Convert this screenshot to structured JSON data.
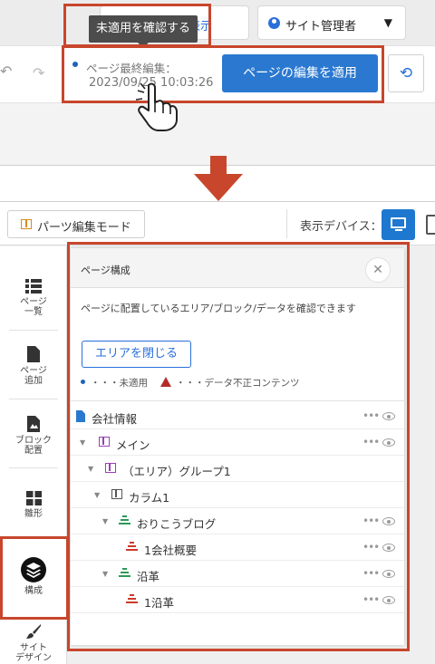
{
  "top": {
    "public_page_button": "公開画面を表示",
    "site_admin_label": "サイト管理者",
    "last_edit_label": "ページ最終編集：",
    "last_edit_date": "2023/09/25 10:03:26",
    "apply_button": "ページの編集を適用",
    "tooltip": "未適用を確認する"
  },
  "toolbar": {
    "parts_mode_button": "パーツ編集モード",
    "display_device_label": "表示デバイス："
  },
  "sidebar": {
    "items": [
      {
        "label": "ページ\n一覧",
        "icon": "list-icon"
      },
      {
        "label": "ページ\n追加",
        "icon": "page-add-icon"
      },
      {
        "label": "ブロック\n配置",
        "icon": "block-place-icon"
      },
      {
        "label": "雛形",
        "icon": "template-icon"
      },
      {
        "label": "構成",
        "icon": "layers-icon",
        "active": true
      },
      {
        "label": "サイト\nデザイン",
        "icon": "brush-icon"
      }
    ]
  },
  "panel": {
    "title": "ページ構成",
    "description": "ページに配置しているエリア/ブロック/データを確認できます",
    "close_area_button": "エリアを閉じる",
    "legend_unapplied": "・・・未適用",
    "legend_invalid": "・・・データ不正コンテンツ",
    "tree": [
      {
        "label": "会社情報",
        "type": "page",
        "unapplied": false
      },
      {
        "label": "メイン",
        "type": "area",
        "unapplied": false
      },
      {
        "label": "（エリア）グループ1",
        "type": "area",
        "unapplied": false
      },
      {
        "label": "カラム1",
        "type": "column",
        "unapplied": false
      },
      {
        "label": "おりこうブログ",
        "type": "block-green",
        "unapplied": true
      },
      {
        "label": "1会社概要",
        "type": "block-red",
        "unapplied": true
      },
      {
        "label": "沿革",
        "type": "block-green",
        "unapplied": false
      },
      {
        "label": "1沿革",
        "type": "block-red",
        "unapplied": false
      }
    ]
  },
  "colors": {
    "accent_blue": "#2a78d0",
    "highlight_red": "#c8462c",
    "unapplied_dot": "#1e64b8",
    "warning_red": "#b52b2b"
  }
}
